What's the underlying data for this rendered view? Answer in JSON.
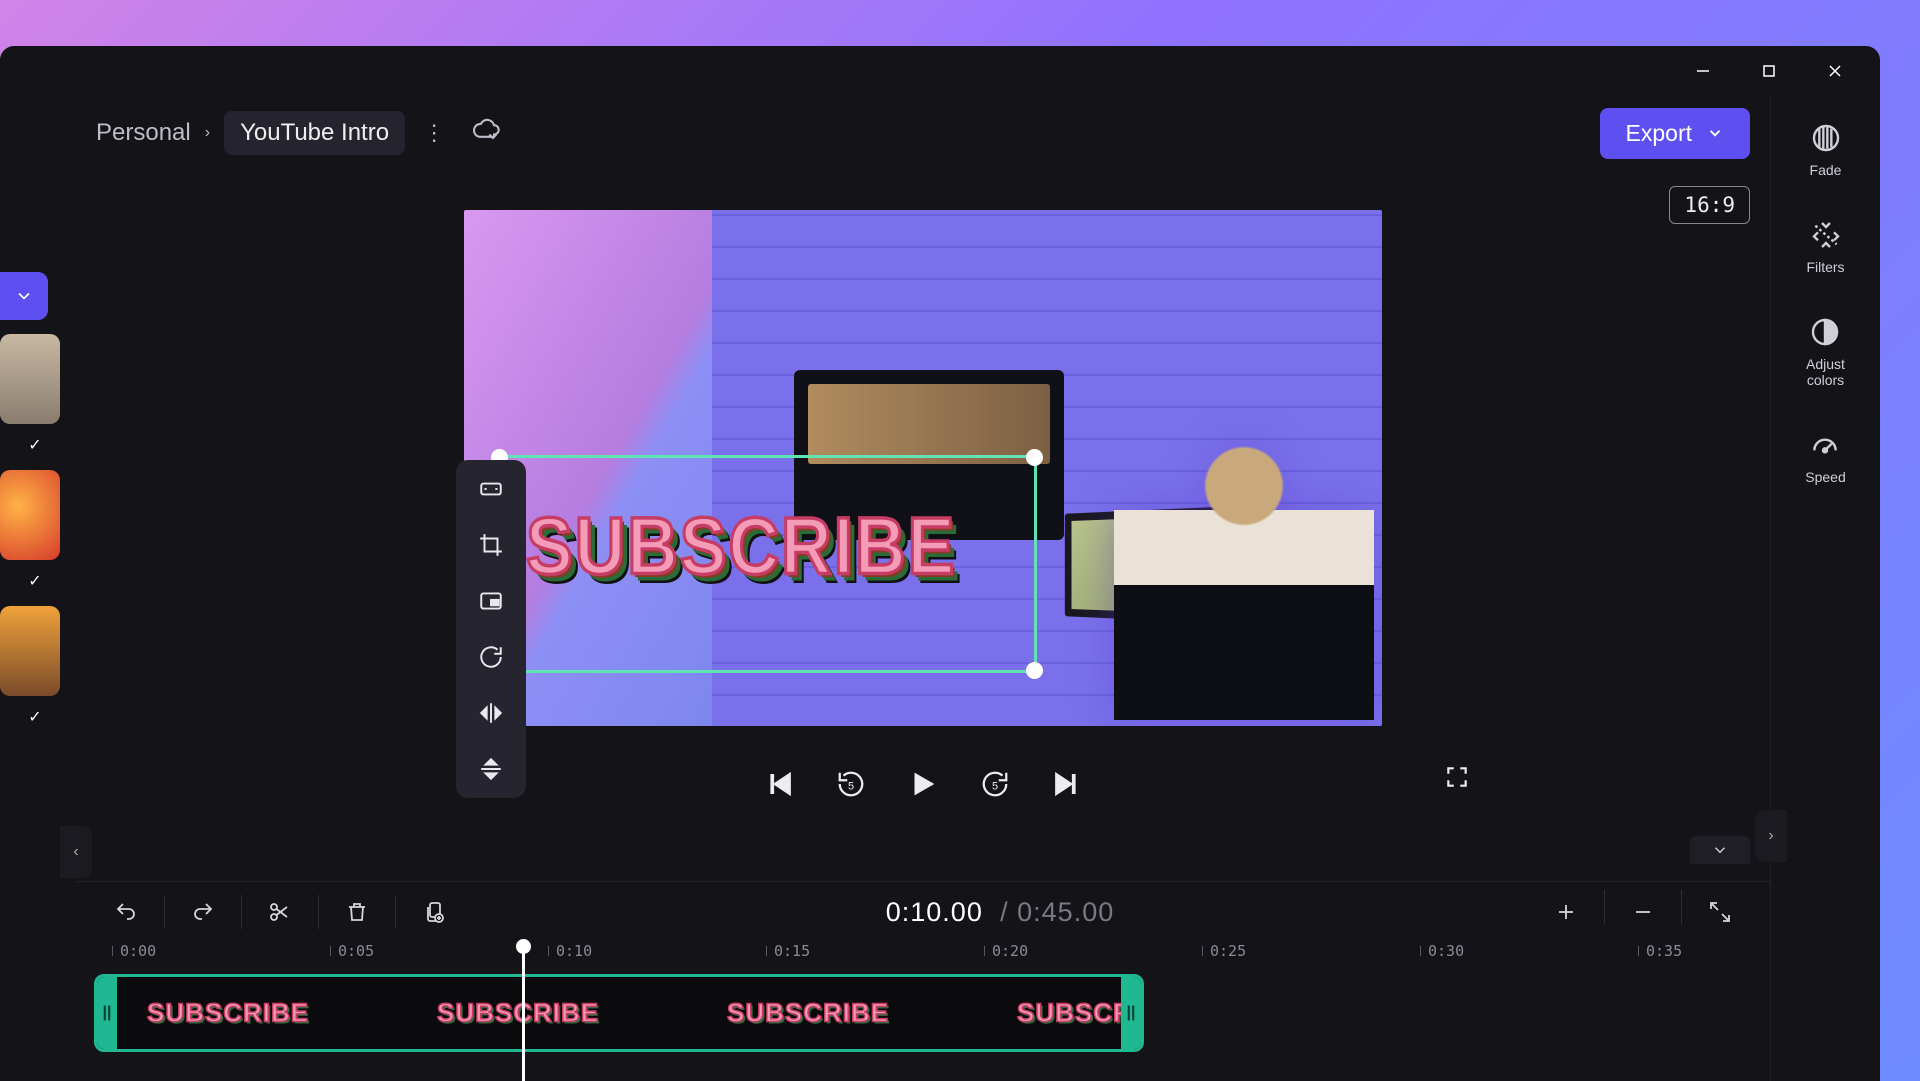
{
  "window": {
    "minimize": "–",
    "maximize": "☐",
    "close": "✕"
  },
  "breadcrumb": {
    "root": "Personal",
    "project": "YouTube Intro"
  },
  "topbar": {
    "export_label": "Export",
    "aspect": "16:9"
  },
  "preview": {
    "sticker_text": "SUBSCRIBE"
  },
  "obj_tools": {
    "fit": "fit",
    "crop": "crop",
    "pip": "pip",
    "rotate": "rotate",
    "flip_h": "flip-h",
    "flip_v": "flip-v"
  },
  "playback": {
    "rewind_sec": "5",
    "forward_sec": "5"
  },
  "right_tools": [
    {
      "id": "fade",
      "label": "Fade"
    },
    {
      "id": "filters",
      "label": "Filters"
    },
    {
      "id": "adjust",
      "label": "Adjust\ncolors"
    },
    {
      "id": "speed",
      "label": "Speed"
    }
  ],
  "timeline": {
    "current": "0:10.00",
    "sep": "/",
    "total": "0:45.00",
    "ticks": [
      "0:00",
      "0:05",
      "0:10",
      "0:15",
      "0:20",
      "0:25",
      "0:30",
      "0:35"
    ],
    "clip_label": "SUBSCRIBE"
  }
}
